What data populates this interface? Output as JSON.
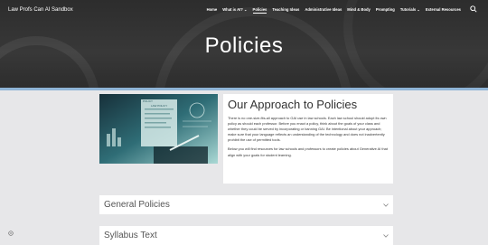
{
  "header": {
    "site_title": "Law Profs Can AI Sandbox",
    "nav": [
      {
        "label": "Home",
        "active": false,
        "has_dropdown": false
      },
      {
        "label": "What is AI?",
        "active": false,
        "has_dropdown": true
      },
      {
        "label": "Policies",
        "active": true,
        "has_dropdown": false
      },
      {
        "label": "Teaching Ideas",
        "active": false,
        "has_dropdown": false
      },
      {
        "label": "Administrative Ideas",
        "active": false,
        "has_dropdown": false
      },
      {
        "label": "Mind & Body",
        "active": false,
        "has_dropdown": false
      },
      {
        "label": "Prompting",
        "active": false,
        "has_dropdown": false
      },
      {
        "label": "Tutorials",
        "active": false,
        "has_dropdown": true
      },
      {
        "label": "External Resources",
        "active": false,
        "has_dropdown": false
      }
    ],
    "search_icon": "search-icon",
    "accent_color": "#8fb4d6"
  },
  "hero": {
    "title": "Policies"
  },
  "intro": {
    "heading": "Our Approach to Policies",
    "paragraphs": [
      "There is no one-size-fits-all approach to GAI use in law schools. Each law school should adopt its own policy as should each professor. Before you enact a policy, think about the goals of your class and whether they could be served by incorporating or banning GAI. Be intentional about your approach; make sure that your language reflects an understanding of the technology and does not inadvertently prohibit the use of permitted tools.",
      "Below you will find resources for law schools and professors to create policies about Generative AI that align with your goals for student learning."
    ],
    "image_texts": [
      "POLICY",
      "LAW POLICY"
    ]
  },
  "accordions": [
    {
      "label": "General Policies",
      "expanded": false
    },
    {
      "label": "Syllabus Text",
      "expanded": false
    }
  ]
}
